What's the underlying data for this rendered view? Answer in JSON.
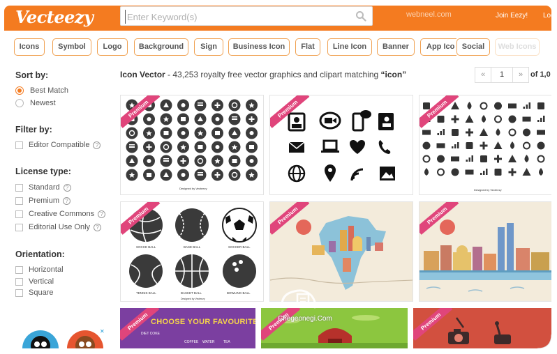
{
  "header": {
    "logo": "Vecteezy",
    "search_placeholder": "Enter Keyword(s)",
    "watermark": "webneel.com",
    "join": "Join Eezy!",
    "login": "Log",
    "brand_color": "#f47b20"
  },
  "tags": [
    "Icons",
    "Symbol",
    "Logo",
    "Background",
    "Sign",
    "Business Icon",
    "Flat",
    "Line Icon",
    "Banner",
    "App Ico",
    "Social",
    "Web Icons"
  ],
  "sidebar": {
    "sort_title": "Sort by:",
    "sort_options": [
      "Best Match",
      "Newest"
    ],
    "filter_title": "Filter by:",
    "filter_options": [
      "Editor Compatible"
    ],
    "license_title": "License type:",
    "license_options": [
      "Standard",
      "Premium",
      "Creative Commons",
      "Editorial Use Only"
    ],
    "orientation_title": "Orientation:",
    "orientation_options": [
      "Horizontal",
      "Vertical",
      "Square"
    ],
    "help_glyph": "?"
  },
  "results": {
    "title": "Icon Vector",
    "summary": " - 43,253 royalty free vector graphics and clipart matching ",
    "query": "“icon”",
    "page": "1",
    "of_text": "of 1,0",
    "prev": "«",
    "next": "»"
  },
  "cards": {
    "premium_label": "Premium",
    "c1_caption": "Designed by Vecteezy",
    "c3_caption": "Designed by Vecteezy",
    "balls": [
      "SOCCE BALL",
      "BASE BALL",
      "SOCCER BALL",
      "TENNIS BALL",
      "BASKET BALL",
      "BOWLING BALL"
    ],
    "c4_caption": "Designed by Vecteezy",
    "c7_title": "CHOOSE YOUR FAVOURITE",
    "c7_items": [
      "DIET COKE",
      "COFFEE",
      "WATER",
      "TEA"
    ]
  },
  "watermark_bottom": "Chegeonegi.Com"
}
